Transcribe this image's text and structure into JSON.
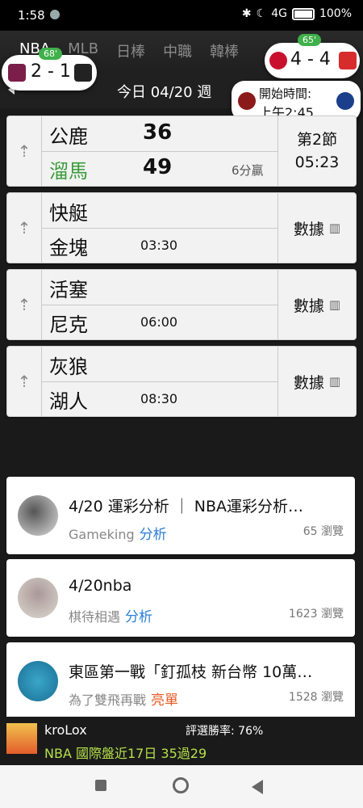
{
  "status": {
    "time": "1:58",
    "battery": "100%",
    "signal": "4G"
  },
  "tabs": [
    "NBA",
    "MLB",
    "日棒",
    "中職",
    "韓棒"
  ],
  "date_header": "今日 04/20 週",
  "overlay": {
    "left_game": {
      "score": "2 - 1",
      "minute": "68'"
    },
    "right_game": {
      "score": "4 - 4",
      "minute": "65'"
    },
    "upcoming": {
      "label": "開始時間:",
      "time": "上午2:45"
    }
  },
  "games": [
    {
      "home": "公鹿",
      "away": "溜馬",
      "home_score": "36",
      "away_score": "49",
      "lead": "6分贏",
      "period": "第2節",
      "clock": "05:23"
    },
    {
      "home": "快艇",
      "away": "金塊",
      "time": "03:30",
      "stat_label": "數據"
    },
    {
      "home": "活塞",
      "away": "尼克",
      "time": "06:00",
      "stat_label": "數據"
    },
    {
      "home": "灰狼",
      "away": "湖人",
      "time": "08:30",
      "stat_label": "數據"
    }
  ],
  "articles": [
    {
      "title": "4/20 運彩分析 ｜ NBA運彩分析…",
      "author": "Gameking",
      "tag": "分析",
      "tag_color": "#2b7fd6",
      "views": "65 瀏覽"
    },
    {
      "title": "4/20nba",
      "author": "棋待相遇",
      "tag": "分析",
      "tag_color": "#2b7fd6",
      "views": "1623 瀏覽"
    },
    {
      "title": "東區第一戰「釘孤枝 新台幣 10萬…",
      "author": "為了雙飛再戰",
      "tag": "亮單",
      "tag_color": "#e85a24",
      "views": "1528 瀏覽"
    }
  ],
  "banner": {
    "user": "kroLox",
    "rate": "評選勝率: 76%",
    "record": "NBA 國際盤近17日 35過29"
  }
}
